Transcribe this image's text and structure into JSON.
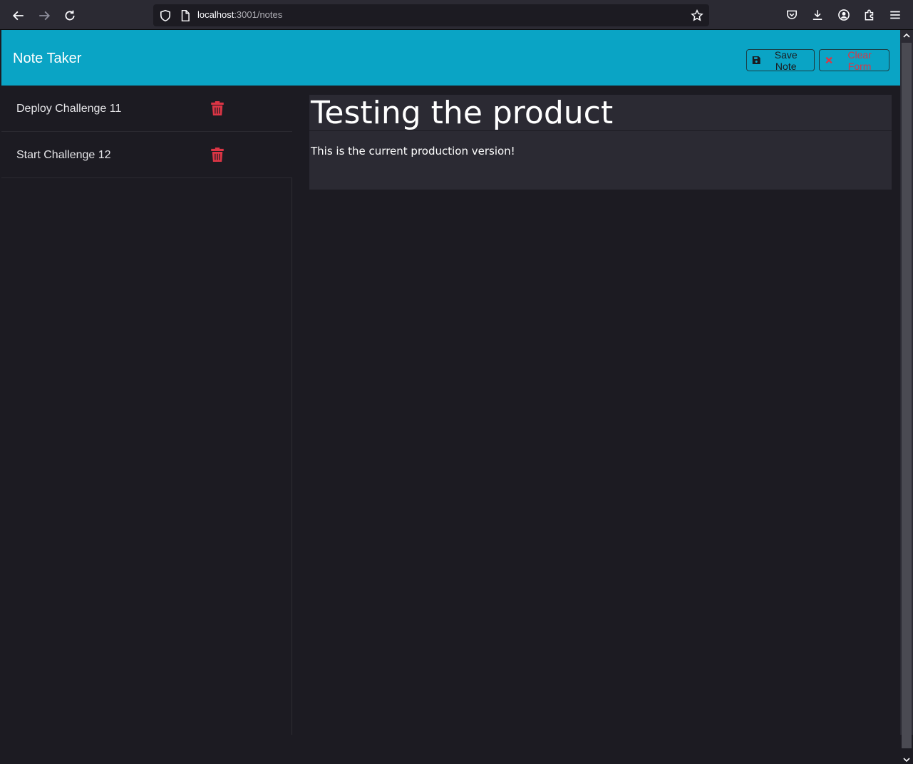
{
  "browser": {
    "url_host": "localhost",
    "url_path": ":3001/notes"
  },
  "app": {
    "brand": "Note Taker",
    "save_label": "Save Note",
    "clear_label": "Clear Form",
    "accent": "#0aa4c5",
    "danger": "#dc3545"
  },
  "notes": [
    {
      "title": "Deploy Challenge 11"
    },
    {
      "title": "Start Challenge 12"
    }
  ],
  "editor": {
    "title_value": "Testing the product",
    "body_value": "This is the current production version!"
  }
}
